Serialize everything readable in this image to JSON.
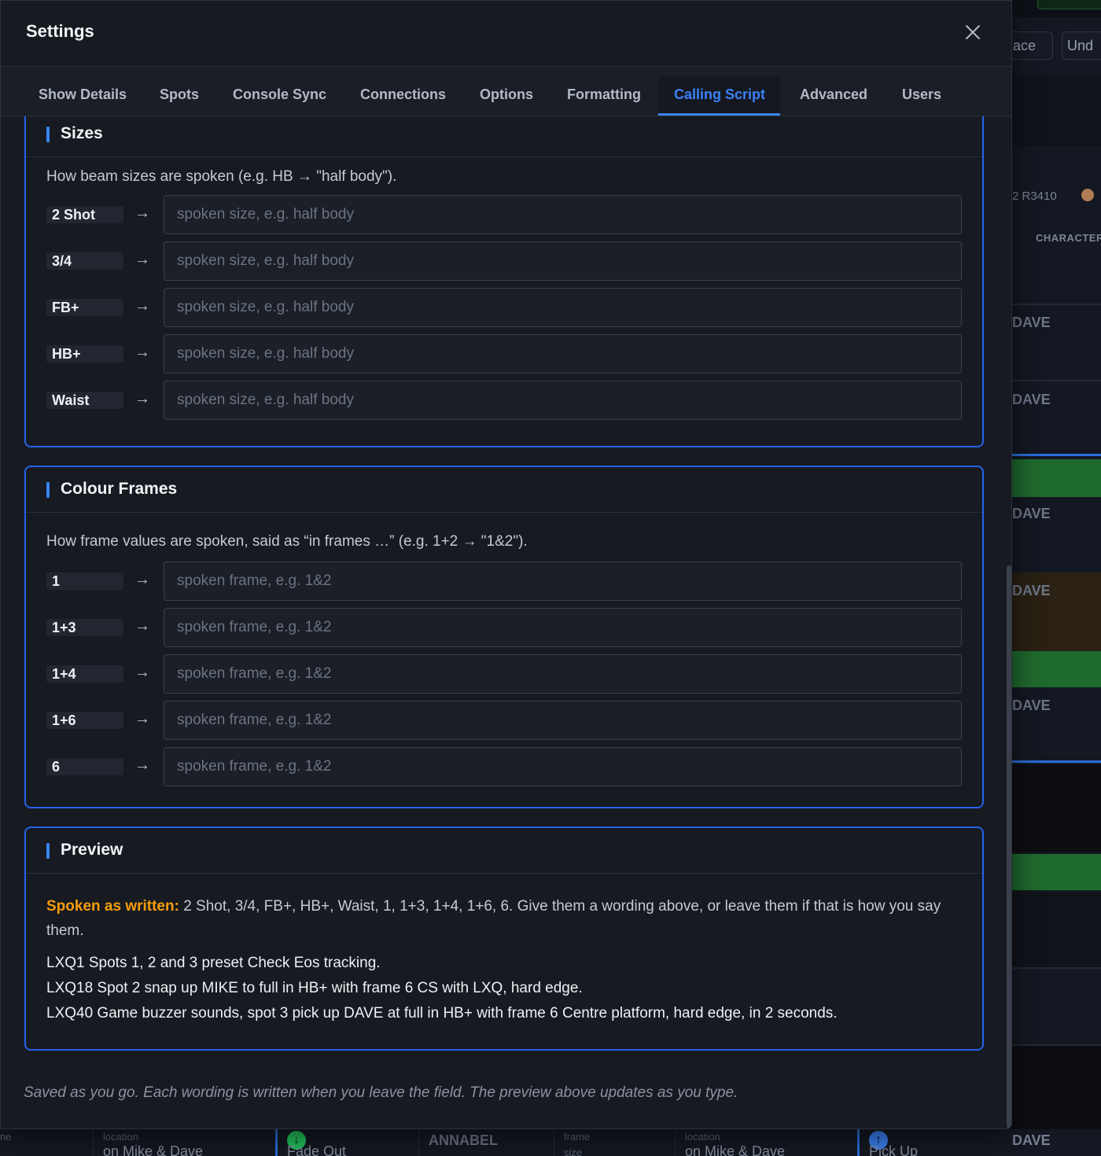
{
  "background": {
    "buttons": [
      "lace",
      "Und"
    ],
    "badge": "2  R3410",
    "column_header": "CHARACTER",
    "dave_labels": [
      "DAVE",
      "DAVE",
      "DAVE",
      "DAVE",
      "DAVE"
    ],
    "bottom_row": {
      "location_label": "location",
      "location_value": "on Mike & Dave",
      "cue_action": "Fade Out",
      "character": "ANNABEL",
      "frame_label": "frame",
      "size_label": "size",
      "location_label_2": "location",
      "location_value_2": "on Mike & Dave",
      "cue_action_2": "Pick Up",
      "character_2": "DAVE",
      "left_fragment": "ne"
    }
  },
  "modal": {
    "title": "Settings",
    "tabs": [
      {
        "label": "Show Details"
      },
      {
        "label": "Spots"
      },
      {
        "label": "Console Sync"
      },
      {
        "label": "Connections"
      },
      {
        "label": "Options"
      },
      {
        "label": "Formatting"
      },
      {
        "label": "Calling Script",
        "active": true
      },
      {
        "label": "Advanced"
      },
      {
        "label": "Users"
      }
    ],
    "sizes": {
      "title": "Sizes",
      "description": "How beam sizes are spoken (e.g. HB → \"half body\").",
      "placeholder": "spoken size, e.g. half body",
      "arrow": "→",
      "rows": [
        {
          "key": "2 Shot",
          "value": ""
        },
        {
          "key": "3/4",
          "value": ""
        },
        {
          "key": "FB+",
          "value": ""
        },
        {
          "key": "HB+",
          "value": ""
        },
        {
          "key": "Waist",
          "value": ""
        }
      ]
    },
    "frames": {
      "title": "Colour Frames",
      "description": "How frame values are spoken, said as “in frames …” (e.g. 1+2 → \"1&2\").",
      "placeholder": "spoken frame, e.g. 1&2",
      "arrow": "→",
      "rows": [
        {
          "key": "1",
          "value": ""
        },
        {
          "key": "1+3",
          "value": ""
        },
        {
          "key": "1+4",
          "value": ""
        },
        {
          "key": "1+6",
          "value": ""
        },
        {
          "key": "6",
          "value": ""
        }
      ]
    },
    "preview": {
      "title": "Preview",
      "warning_label": "Spoken as written:",
      "warning_text": " 2 Shot, 3/4, FB+, HB+, Waist, 1, 1+3, 1+4, 1+6, 6. Give them a wording above, or leave them if that is how you say them.",
      "lines": [
        "LXQ1 Spots 1, 2 and 3 preset Check Eos tracking.",
        "LXQ18 Spot 2 snap up MIKE to full in HB+ with frame 6 CS with LXQ, hard edge.",
        "LXQ40 Game buzzer sounds, spot 3 pick up DAVE at full in HB+ with frame 6 Centre platform, hard edge, in 2 seconds."
      ]
    },
    "footer_note": "Saved as you go. Each wording is written when you leave the field. The preview above updates as you type."
  },
  "colors": {
    "accent": "#3b82f6",
    "section_border": "#2563eb",
    "warning": "#f59e0b",
    "modal_bg": "#171a21"
  }
}
